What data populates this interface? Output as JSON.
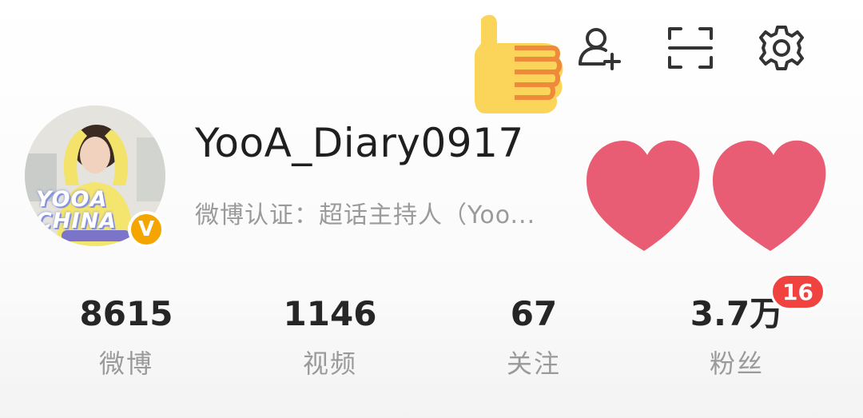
{
  "header": {
    "icons": [
      "add-user-icon",
      "scan-icon",
      "gear-icon"
    ]
  },
  "profile": {
    "username": "YooA_Diary0917",
    "certification": "微博认证：超话主持人（Yoo...",
    "verified_mark": "V",
    "avatar_text": "YOOA CHINA",
    "verified_color": "#f5a500"
  },
  "stats": [
    {
      "value": "8615",
      "label": "微博"
    },
    {
      "value": "1146",
      "label": "视频"
    },
    {
      "value": "67",
      "label": "关注"
    },
    {
      "value": "3.7万",
      "label": "粉丝"
    }
  ],
  "fans_badge": "16",
  "colors": {
    "badge_red": "#f0433f",
    "muted_text": "#9a9a9a"
  }
}
